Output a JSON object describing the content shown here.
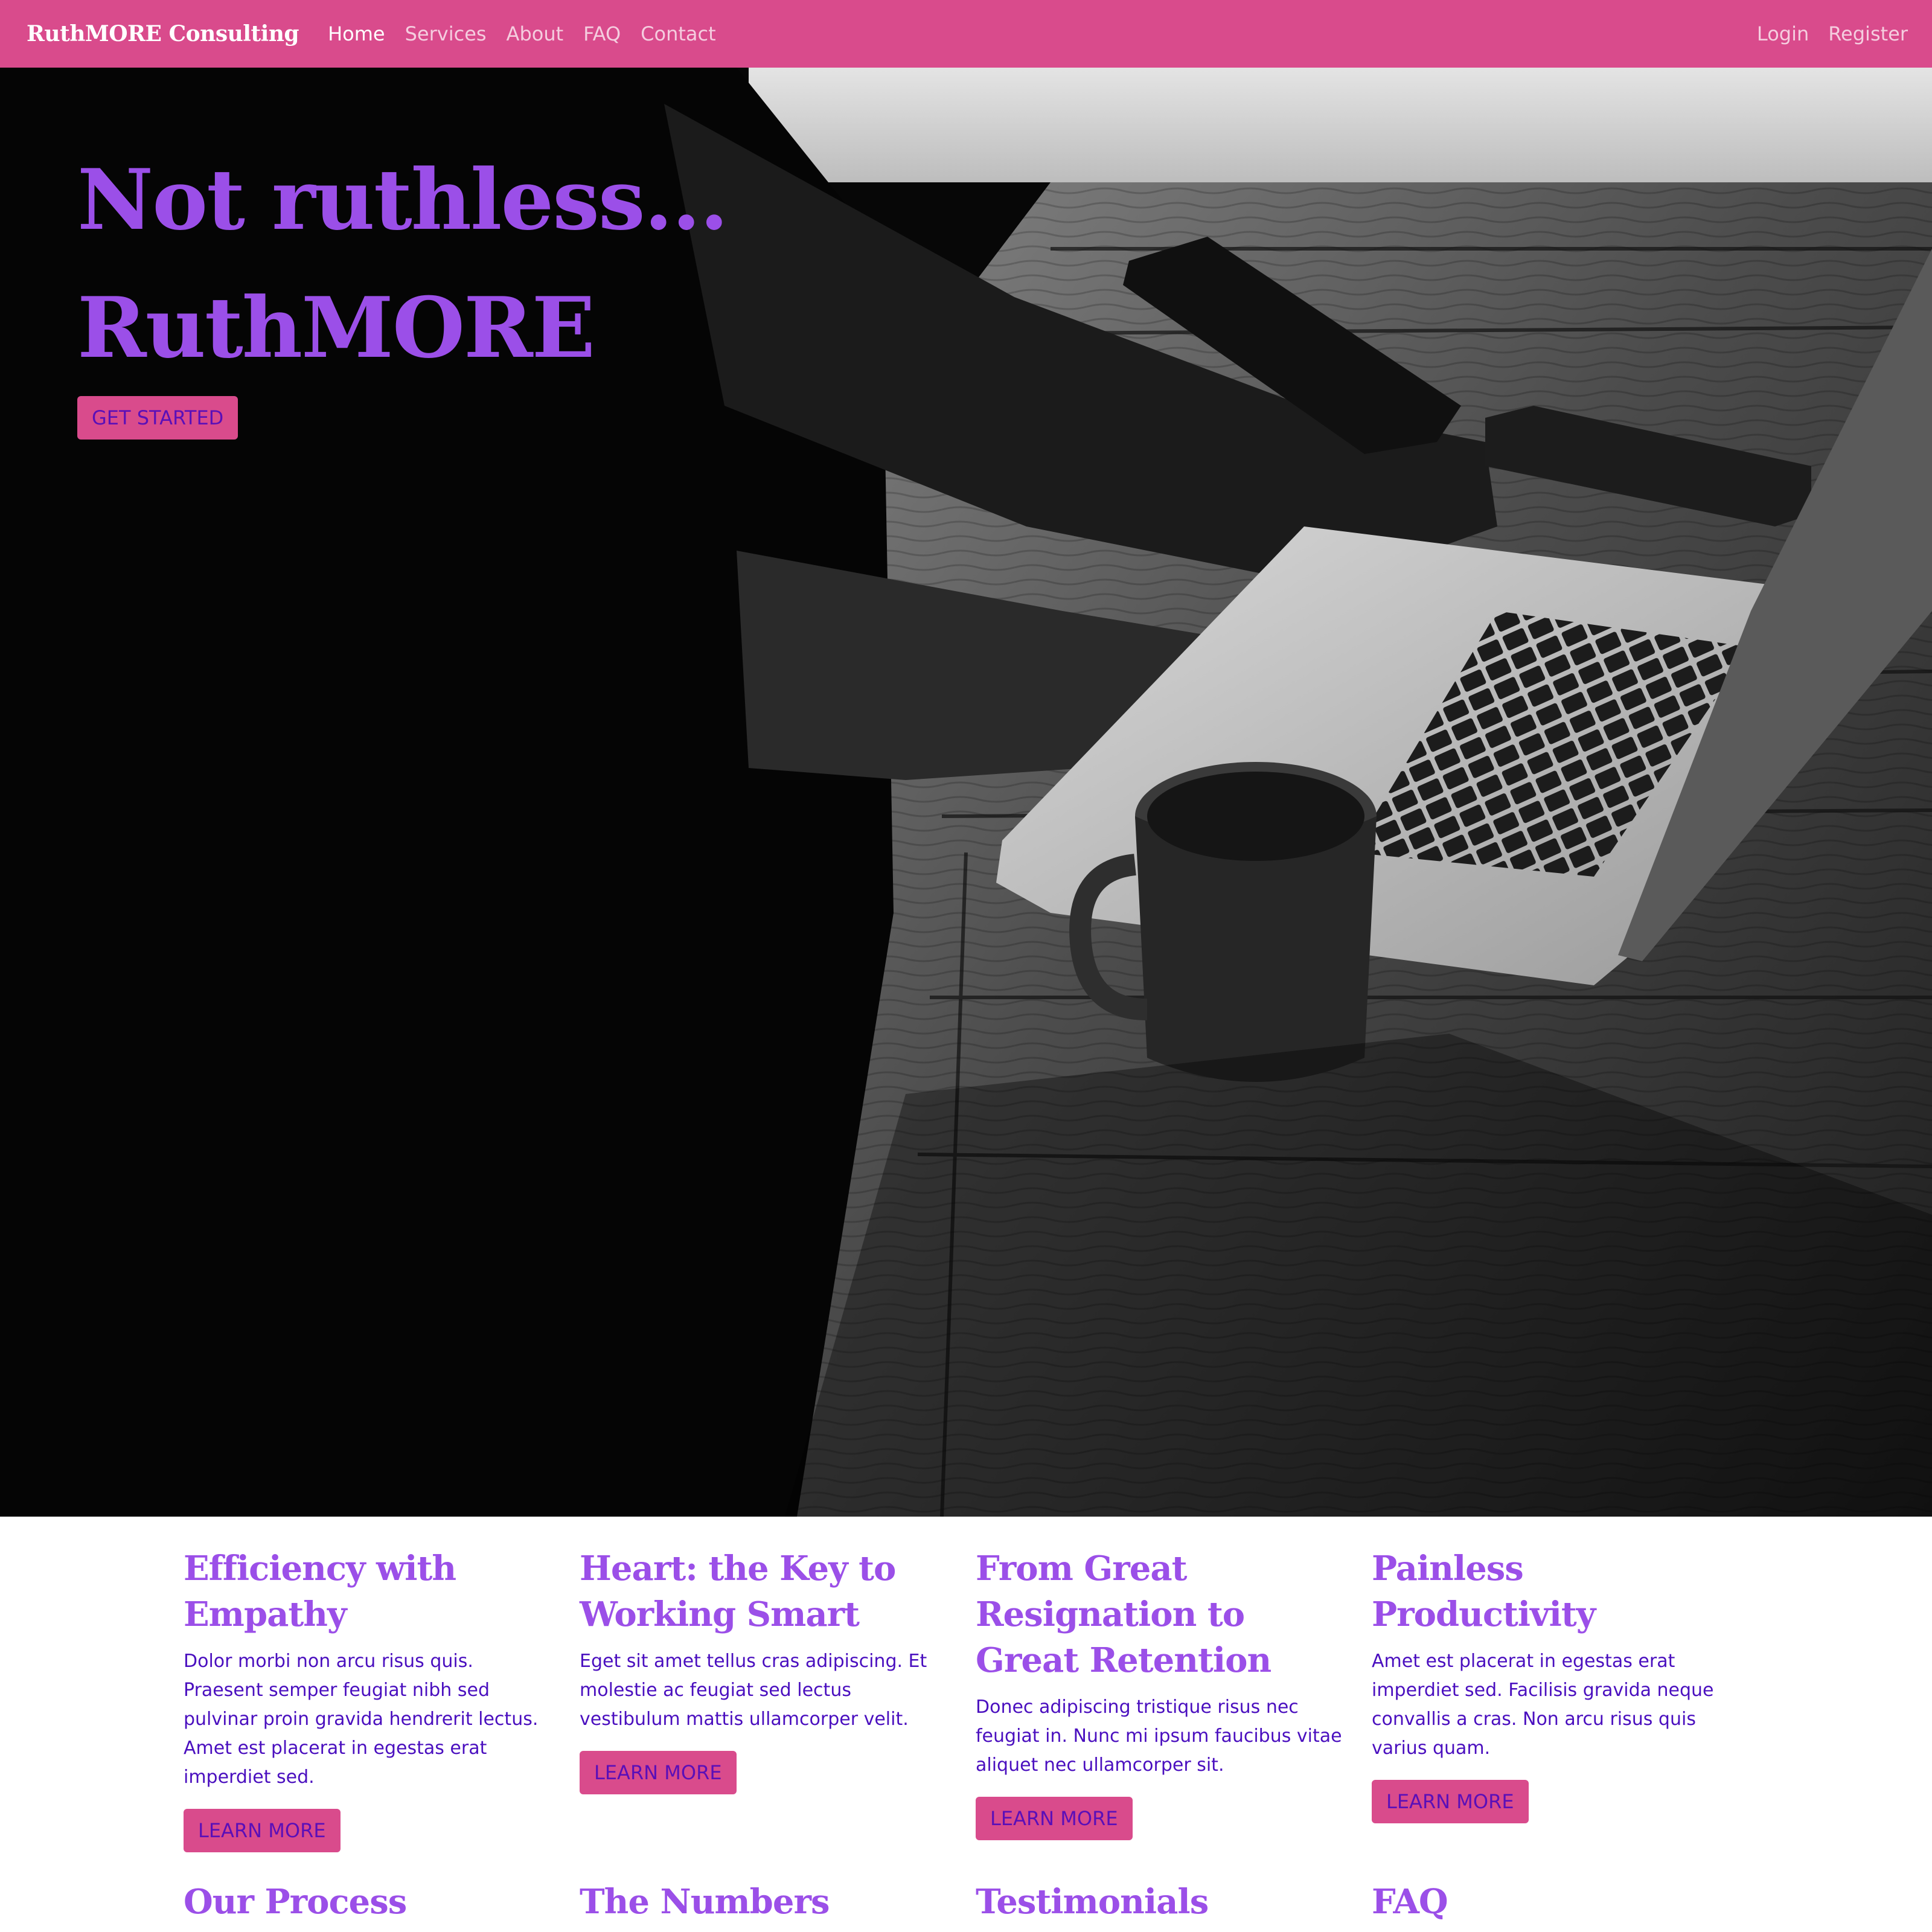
{
  "nav": {
    "brand": "RuthMORE Consulting",
    "links": [
      "Home",
      "Services",
      "About",
      "FAQ",
      "Contact"
    ],
    "active": "Home",
    "right_links": [
      "Login",
      "Register"
    ]
  },
  "hero": {
    "title_line1": "Not ruthless...",
    "title_line2": "RuthMORE",
    "cta_label": "GET STARTED"
  },
  "features": [
    {
      "title": "Efficiency with Empathy",
      "text": "Dolor morbi non arcu risus quis. Praesent semper feugiat nibh sed pulvinar proin gravida hendrerit lectus. Amet est placerat in egestas erat imperdiet sed.",
      "button": "LEARN MORE"
    },
    {
      "title": "Heart: the Key to Working Smart",
      "text": "Eget sit amet tellus cras adipiscing. Et molestie ac feugiat sed lectus vestibulum mattis ullamcorper velit.",
      "button": "LEARN MORE"
    },
    {
      "title": "From Great Resignation to Great Retention",
      "text": "Donec adipiscing tristique risus nec feugiat in. Nunc mi ipsum faucibus vitae aliquet nec ullamcorper sit.",
      "button": "LEARN MORE"
    },
    {
      "title": "Painless Productivity",
      "text": "Amet est placerat in egestas erat imperdiet sed. Facilisis gravida neque convallis a cras. Non arcu risus quis varius quam.",
      "button": "LEARN MORE"
    }
  ],
  "sections": [
    "Our Process",
    "The Numbers",
    "Testimonials",
    "FAQ"
  ],
  "colors": {
    "navbar": "#d94b8c",
    "headline": "#9b4fe8",
    "body_text": "#4a0fbf",
    "button_bg": "#d94b8c",
    "button_text": "#5a0fb8"
  }
}
